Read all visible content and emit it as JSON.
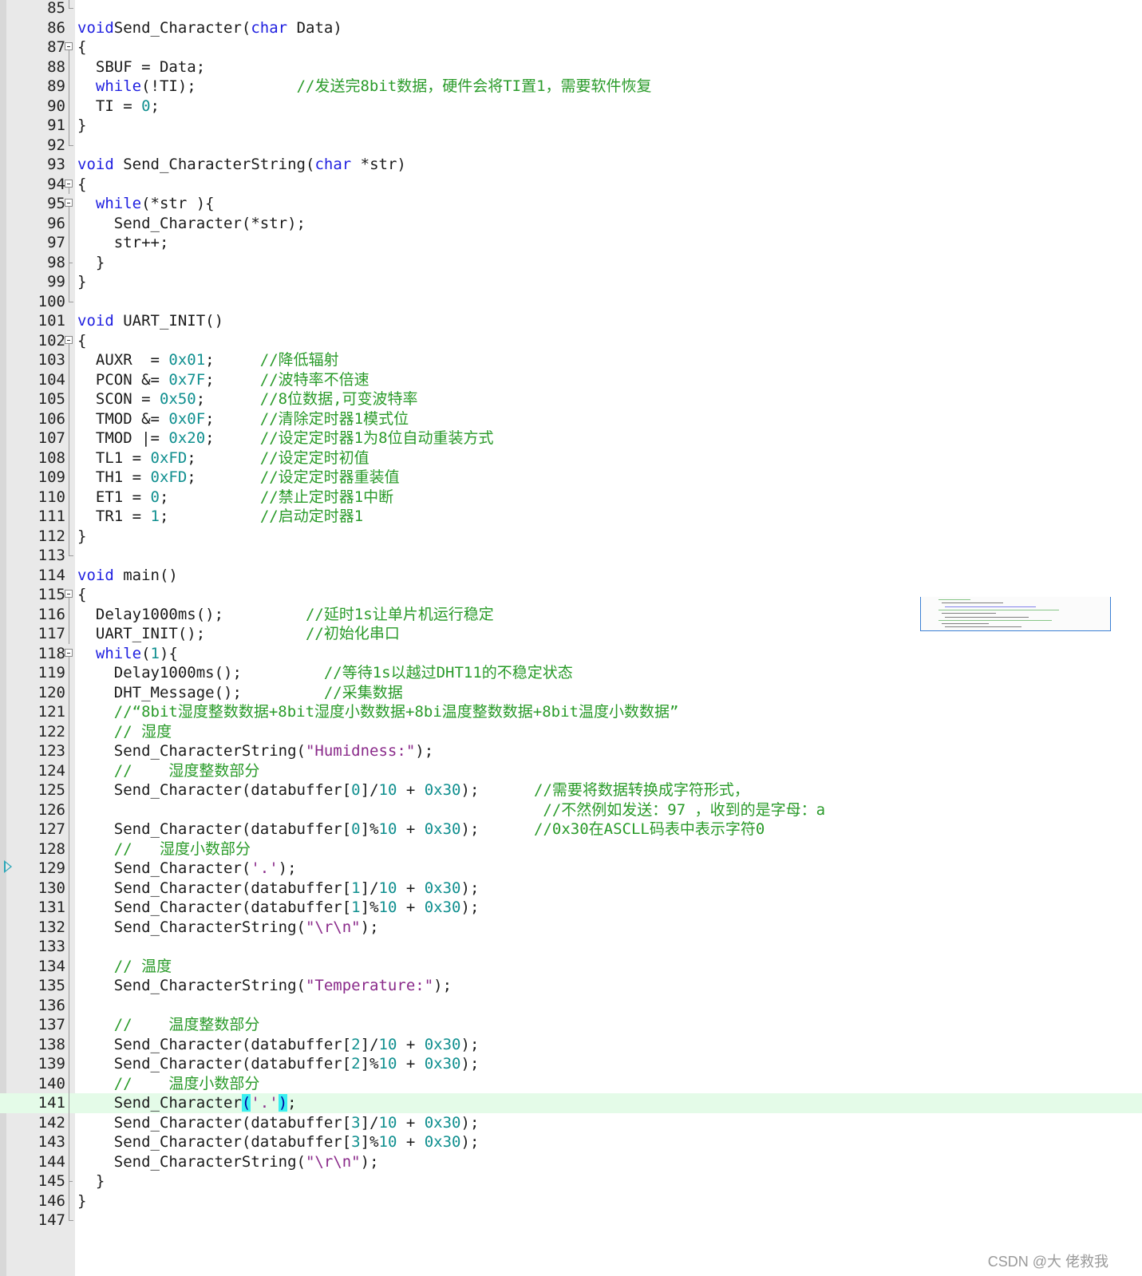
{
  "editor": {
    "current_line": 141,
    "breakpoint_line": 129,
    "lines": [
      {
        "n": "85",
        "fold": "end",
        "segs": []
      },
      {
        "n": "86",
        "fold": "",
        "segs": [
          [
            "kw",
            "void"
          ],
          [
            "",
            "Send_Character("
          ],
          [
            "kw",
            "char"
          ],
          [
            "",
            " Data)"
          ]
        ]
      },
      {
        "n": "87",
        "fold": "open",
        "segs": [
          [
            "",
            "{"
          ]
        ]
      },
      {
        "n": "88",
        "fold": "line",
        "segs": [
          [
            "",
            "  SBUF = Data;"
          ]
        ]
      },
      {
        "n": "89",
        "fold": "line",
        "segs": [
          [
            "",
            "  "
          ],
          [
            "kw",
            "while"
          ],
          [
            "",
            "(!TI);           "
          ],
          [
            "cm",
            "//发送完8bit数据，硬件会将TI置1，需要软件恢复"
          ]
        ]
      },
      {
        "n": "90",
        "fold": "line",
        "segs": [
          [
            "",
            "  TI = "
          ],
          [
            "num",
            "0"
          ],
          [
            "",
            ";"
          ]
        ]
      },
      {
        "n": "91",
        "fold": "line",
        "segs": [
          [
            "",
            "}"
          ]
        ]
      },
      {
        "n": "92",
        "fold": "end",
        "segs": []
      },
      {
        "n": "93",
        "fold": "",
        "segs": [
          [
            "kw",
            "void"
          ],
          [
            "",
            " Send_CharacterString("
          ],
          [
            "kw",
            "char"
          ],
          [
            "",
            " *str)"
          ]
        ]
      },
      {
        "n": "94",
        "fold": "open",
        "segs": [
          [
            "",
            "{"
          ]
        ]
      },
      {
        "n": "95",
        "fold": "open",
        "segs": [
          [
            "",
            "  "
          ],
          [
            "kw",
            "while"
          ],
          [
            "",
            "(*str ){"
          ]
        ]
      },
      {
        "n": "96",
        "fold": "line",
        "segs": [
          [
            "",
            "    Send_Character(*str);"
          ]
        ]
      },
      {
        "n": "97",
        "fold": "line",
        "segs": [
          [
            "",
            "    str++;"
          ]
        ]
      },
      {
        "n": "98",
        "fold": "tick",
        "segs": [
          [
            "",
            "  }"
          ]
        ]
      },
      {
        "n": "99",
        "fold": "line",
        "segs": [
          [
            "",
            "}"
          ]
        ]
      },
      {
        "n": "100",
        "fold": "end",
        "segs": []
      },
      {
        "n": "101",
        "fold": "",
        "segs": [
          [
            "kw",
            "void"
          ],
          [
            "",
            " UART_INIT()"
          ]
        ]
      },
      {
        "n": "102",
        "fold": "open",
        "segs": [
          [
            "",
            "{"
          ]
        ]
      },
      {
        "n": "103",
        "fold": "line",
        "segs": [
          [
            "",
            "  AUXR  = "
          ],
          [
            "num",
            "0x01"
          ],
          [
            "",
            ";     "
          ],
          [
            "cm",
            "//降低辐射"
          ]
        ]
      },
      {
        "n": "104",
        "fold": "line",
        "segs": [
          [
            "",
            "  PCON &= "
          ],
          [
            "num",
            "0x7F"
          ],
          [
            "",
            ";     "
          ],
          [
            "cm",
            "//波特率不倍速"
          ]
        ]
      },
      {
        "n": "105",
        "fold": "line",
        "segs": [
          [
            "",
            "  SCON = "
          ],
          [
            "num",
            "0x50"
          ],
          [
            "",
            ";      "
          ],
          [
            "cm",
            "//8位数据,可变波特率"
          ]
        ]
      },
      {
        "n": "106",
        "fold": "line",
        "segs": [
          [
            "",
            "  TMOD &= "
          ],
          [
            "num",
            "0x0F"
          ],
          [
            "",
            ";     "
          ],
          [
            "cm",
            "//清除定时器1模式位"
          ]
        ]
      },
      {
        "n": "107",
        "fold": "line",
        "segs": [
          [
            "",
            "  TMOD |= "
          ],
          [
            "num",
            "0x20"
          ],
          [
            "",
            ";     "
          ],
          [
            "cm",
            "//设定定时器1为8位自动重装方式"
          ]
        ]
      },
      {
        "n": "108",
        "fold": "line",
        "segs": [
          [
            "",
            "  TL1 = "
          ],
          [
            "num",
            "0xFD"
          ],
          [
            "",
            ";       "
          ],
          [
            "cm",
            "//设定定时初值"
          ]
        ]
      },
      {
        "n": "109",
        "fold": "line",
        "segs": [
          [
            "",
            "  TH1 = "
          ],
          [
            "num",
            "0xFD"
          ],
          [
            "",
            ";       "
          ],
          [
            "cm",
            "//设定定时器重装值"
          ]
        ]
      },
      {
        "n": "110",
        "fold": "line",
        "segs": [
          [
            "",
            "  ET1 = "
          ],
          [
            "num",
            "0"
          ],
          [
            "",
            ";          "
          ],
          [
            "cm",
            "//禁止定时器1中断"
          ]
        ]
      },
      {
        "n": "111",
        "fold": "line",
        "segs": [
          [
            "",
            "  TR1 = "
          ],
          [
            "num",
            "1"
          ],
          [
            "",
            ";          "
          ],
          [
            "cm",
            "//启动定时器1"
          ]
        ]
      },
      {
        "n": "112",
        "fold": "line",
        "segs": [
          [
            "",
            "}"
          ]
        ]
      },
      {
        "n": "113",
        "fold": "end",
        "segs": []
      },
      {
        "n": "114",
        "fold": "",
        "segs": [
          [
            "kw",
            "void"
          ],
          [
            "",
            " main()"
          ]
        ]
      },
      {
        "n": "115",
        "fold": "open",
        "segs": [
          [
            "",
            "{"
          ]
        ]
      },
      {
        "n": "116",
        "fold": "line",
        "segs": [
          [
            "",
            "  Delay1000ms();         "
          ],
          [
            "cm",
            "//延时1s让单片机运行稳定"
          ]
        ]
      },
      {
        "n": "117",
        "fold": "line",
        "segs": [
          [
            "",
            "  UART_INIT();           "
          ],
          [
            "cm",
            "//初始化串口"
          ]
        ]
      },
      {
        "n": "118",
        "fold": "open",
        "segs": [
          [
            "",
            "  "
          ],
          [
            "kw",
            "while"
          ],
          [
            "",
            "("
          ],
          [
            "num",
            "1"
          ],
          [
            "",
            "){"
          ]
        ]
      },
      {
        "n": "119",
        "fold": "line",
        "segs": [
          [
            "",
            "    Delay1000ms();         "
          ],
          [
            "cm",
            "//等待1s以越过DHT11的不稳定状态"
          ]
        ]
      },
      {
        "n": "120",
        "fold": "line",
        "segs": [
          [
            "",
            "    DHT_Message();         "
          ],
          [
            "cm",
            "//采集数据"
          ]
        ]
      },
      {
        "n": "121",
        "fold": "line",
        "segs": [
          [
            "",
            "    "
          ],
          [
            "cm",
            "//“8bit湿度整数数据+8bit湿度小数数据+8bi温度整数数据+8bit温度小数数据”"
          ]
        ]
      },
      {
        "n": "122",
        "fold": "line",
        "segs": [
          [
            "",
            "    "
          ],
          [
            "cm",
            "// 湿度"
          ]
        ]
      },
      {
        "n": "123",
        "fold": "line",
        "segs": [
          [
            "",
            "    Send_CharacterString("
          ],
          [
            "str",
            "\"Humidness:\""
          ],
          [
            "",
            ");"
          ]
        ]
      },
      {
        "n": "124",
        "fold": "line",
        "segs": [
          [
            "",
            "    "
          ],
          [
            "cm",
            "//    湿度整数部分"
          ]
        ]
      },
      {
        "n": "125",
        "fold": "line",
        "segs": [
          [
            "",
            "    Send_Character(databuffer["
          ],
          [
            "num",
            "0"
          ],
          [
            "",
            "]/"
          ],
          [
            "num",
            "10"
          ],
          [
            "",
            " + "
          ],
          [
            "num",
            "0x30"
          ],
          [
            "",
            ");      "
          ],
          [
            "cm",
            "//需要将数据转换成字符形式，"
          ]
        ]
      },
      {
        "n": "126",
        "fold": "line",
        "segs": [
          [
            "",
            "                                                   "
          ],
          [
            "cm",
            "//不然例如发送：97 ，收到的是字母：a"
          ]
        ]
      },
      {
        "n": "127",
        "fold": "line",
        "segs": [
          [
            "",
            "    Send_Character(databuffer["
          ],
          [
            "num",
            "0"
          ],
          [
            "",
            "]%"
          ],
          [
            "num",
            "10"
          ],
          [
            "",
            " + "
          ],
          [
            "num",
            "0x30"
          ],
          [
            "",
            ");      "
          ],
          [
            "cm",
            "//0x30在ASCLL码表中表示字符0"
          ]
        ]
      },
      {
        "n": "128",
        "fold": "line",
        "segs": [
          [
            "",
            "    "
          ],
          [
            "cm",
            "//   湿度小数部分"
          ]
        ]
      },
      {
        "n": "129",
        "fold": "line",
        "segs": [
          [
            "",
            "    Send_Character("
          ],
          [
            "str",
            "'.'"
          ],
          [
            "",
            ");"
          ]
        ]
      },
      {
        "n": "130",
        "fold": "line",
        "segs": [
          [
            "",
            "    Send_Character(databuffer["
          ],
          [
            "num",
            "1"
          ],
          [
            "",
            "]/"
          ],
          [
            "num",
            "10"
          ],
          [
            "",
            " + "
          ],
          [
            "num",
            "0x30"
          ],
          [
            "",
            ");"
          ]
        ]
      },
      {
        "n": "131",
        "fold": "line",
        "segs": [
          [
            "",
            "    Send_Character(databuffer["
          ],
          [
            "num",
            "1"
          ],
          [
            "",
            "]%"
          ],
          [
            "num",
            "10"
          ],
          [
            "",
            " + "
          ],
          [
            "num",
            "0x30"
          ],
          [
            "",
            ");"
          ]
        ]
      },
      {
        "n": "132",
        "fold": "line",
        "segs": [
          [
            "",
            "    Send_CharacterString("
          ],
          [
            "str",
            "\"\\r\\n\""
          ],
          [
            "",
            ");"
          ]
        ]
      },
      {
        "n": "133",
        "fold": "line",
        "segs": []
      },
      {
        "n": "134",
        "fold": "line",
        "segs": [
          [
            "",
            "    "
          ],
          [
            "cm",
            "// 温度"
          ]
        ]
      },
      {
        "n": "135",
        "fold": "line",
        "segs": [
          [
            "",
            "    Send_CharacterString("
          ],
          [
            "str",
            "\"Temperature:\""
          ],
          [
            "",
            ");"
          ]
        ]
      },
      {
        "n": "136",
        "fold": "line",
        "segs": []
      },
      {
        "n": "137",
        "fold": "line",
        "segs": [
          [
            "",
            "    "
          ],
          [
            "cm",
            "//    温度整数部分"
          ]
        ]
      },
      {
        "n": "138",
        "fold": "line",
        "segs": [
          [
            "",
            "    Send_Character(databuffer["
          ],
          [
            "num",
            "2"
          ],
          [
            "",
            "]/"
          ],
          [
            "num",
            "10"
          ],
          [
            "",
            " + "
          ],
          [
            "num",
            "0x30"
          ],
          [
            "",
            ");"
          ]
        ]
      },
      {
        "n": "139",
        "fold": "line",
        "segs": [
          [
            "",
            "    Send_Character(databuffer["
          ],
          [
            "num",
            "2"
          ],
          [
            "",
            "]%"
          ],
          [
            "num",
            "10"
          ],
          [
            "",
            " + "
          ],
          [
            "num",
            "0x30"
          ],
          [
            "",
            ");"
          ]
        ]
      },
      {
        "n": "140",
        "fold": "line",
        "segs": [
          [
            "",
            "    "
          ],
          [
            "cm",
            "//    温度小数部分"
          ]
        ]
      },
      {
        "n": "141",
        "fold": "line",
        "segs": [
          [
            "",
            "    Send_Character"
          ],
          [
            "hl",
            "("
          ],
          [
            "str",
            "'.'"
          ],
          [
            "hl",
            ")"
          ],
          [
            "",
            ";"
          ]
        ]
      },
      {
        "n": "142",
        "fold": "line",
        "segs": [
          [
            "",
            "    Send_Character(databuffer["
          ],
          [
            "num",
            "3"
          ],
          [
            "",
            "]/"
          ],
          [
            "num",
            "10"
          ],
          [
            "",
            " + "
          ],
          [
            "num",
            "0x30"
          ],
          [
            "",
            ");"
          ]
        ]
      },
      {
        "n": "143",
        "fold": "line",
        "segs": [
          [
            "",
            "    Send_Character(databuffer["
          ],
          [
            "num",
            "3"
          ],
          [
            "",
            "]%"
          ],
          [
            "num",
            "10"
          ],
          [
            "",
            " + "
          ],
          [
            "num",
            "0x30"
          ],
          [
            "",
            ");"
          ]
        ]
      },
      {
        "n": "144",
        "fold": "line",
        "segs": [
          [
            "",
            "    Send_CharacterString("
          ],
          [
            "str",
            "\"\\r\\n\""
          ],
          [
            "",
            ");"
          ]
        ]
      },
      {
        "n": "145",
        "fold": "tick",
        "segs": [
          [
            "",
            "  }"
          ]
        ]
      },
      {
        "n": "146",
        "fold": "line",
        "segs": [
          [
            "",
            "}"
          ]
        ]
      },
      {
        "n": "147",
        "fold": "end",
        "segs": []
      }
    ]
  },
  "icons": {
    "breakpoint": "current-line-arrow-icon",
    "fold": "fold-toggle-icon"
  },
  "colors": {
    "keyword": "#1f1fe0",
    "number": "#0f8f8f",
    "string": "#8a2a8a",
    "comment": "#2a9b2a",
    "current_line": "#e4fbe8",
    "brace_match": "#3af0f0"
  },
  "watermark": "CSDN @大 佬救我"
}
